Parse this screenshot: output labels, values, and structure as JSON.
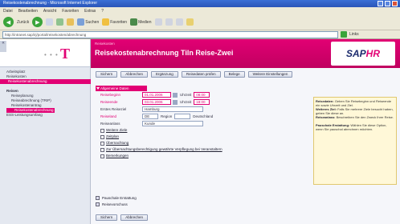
{
  "browser": {
    "title": "Reisekostenabrechnung - Microsoft Internet Explorer",
    "menu": [
      "Datei",
      "Bearbeiten",
      "Ansicht",
      "Favoriten",
      "Extras",
      "?"
    ],
    "toolbar": {
      "back": "Zurück",
      "search": "Suchen",
      "favorites": "Favoriten",
      "media": "Medien"
    },
    "address": "http://intranet.sap/irj/portal/reisekosten/abrechnung",
    "links_label": "Links"
  },
  "nav": {
    "arrow": "«",
    "top_items": [
      "Arbeitsplatz",
      "Reisekosten",
      "Reisekostenabrechnung"
    ],
    "section_head": "Reisen",
    "section_items": [
      "Reiseplanung",
      "Reiseabrechnung (TRIP)",
      "Reisekostenantrag"
    ],
    "selected_item": "Reisekostenabrechnung",
    "last_item": "ESS-Leistungsumfang"
  },
  "header": {
    "crumb": "Reisekosten",
    "title": "Reisekostenabrechnung Tiln Reise-Zwei",
    "sap_logo": "SAP",
    "sap_logo_hr": "HR"
  },
  "buttons_top": [
    "Sichern",
    "Abbrechen",
    "Ergänzung",
    "Reisedaten prüfen",
    "Belege",
    "Weitere Einstellungen"
  ],
  "form": {
    "tray_label": "Allgemeine Daten",
    "rows": [
      {
        "label": "Reisebeginn",
        "value": "01.01.2006",
        "extra_label": "Uhrzeit",
        "extra_value": "08:00"
      },
      {
        "label": "Reiseende",
        "value": "03.01.2006",
        "extra_label": "Uhrzeit",
        "extra_value": "18:00"
      }
    ],
    "zweck_label": "Erstes Reiseziel",
    "zweck_value": "Hamburg",
    "land_label": "Reiseland",
    "land_value": "DE",
    "region_label": "Region",
    "land_text": "Deutschland",
    "anlass_label": "Reiseanlass",
    "anlass_value": "Kunde",
    "links": [
      "Weitere Ziele",
      "Zeitplan",
      "Übernachtung",
      "Zur Übernachtungsberechtigung gewährte Verpflegung bei Veranstaltern",
      "Bemerkungen"
    ]
  },
  "help": {
    "title1": "Reisedaten:",
    "text1": "Geben Sie Reisebeginn und Reiseende ein sowie Uhrzeit und Ziel.",
    "title2": "Weiteres Ziel:",
    "text2": "Falls Sie mehrere Ziele besucht haben, geben Sie diese an.",
    "title3": "Reiseanlass:",
    "text3": "Beschreiben Sie den Zweck Ihrer Reise.",
    "title4": "Pauschale Erstattung:",
    "text4": "Wählen Sie diese Option, wenn Sie pauschal abrechnen möchten."
  },
  "extras": [
    "Pauschale Erstattung",
    "Reisevorschuss"
  ],
  "buttons_bottom": [
    "Sichern",
    "Abbrechen"
  ]
}
